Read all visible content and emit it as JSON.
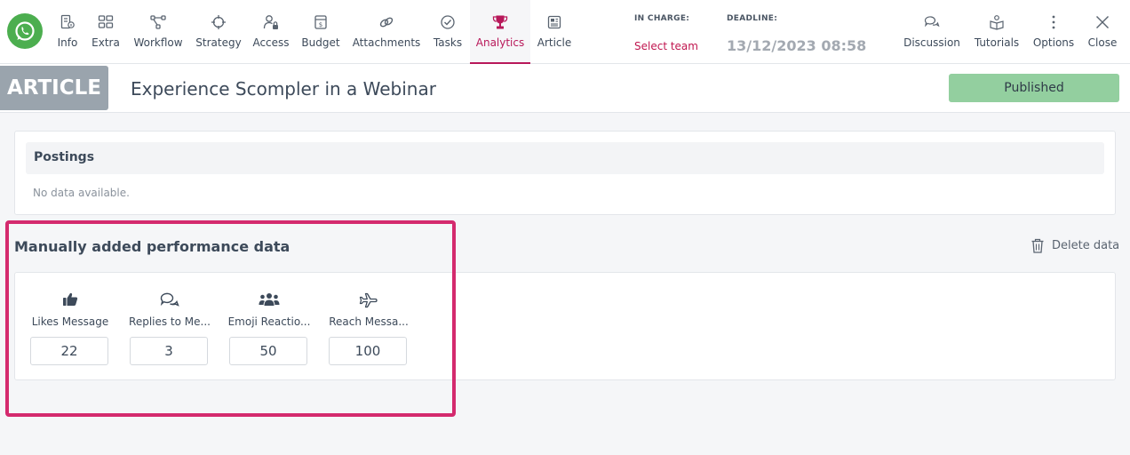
{
  "nav": {
    "items": [
      {
        "label": "Info",
        "icon": "info-doc-icon"
      },
      {
        "label": "Extra",
        "icon": "extra-icon"
      },
      {
        "label": "Workflow",
        "icon": "workflow-icon"
      },
      {
        "label": "Strategy",
        "icon": "crosshair-icon"
      },
      {
        "label": "Access",
        "icon": "user-lock-icon"
      },
      {
        "label": "Budget",
        "icon": "money-icon"
      },
      {
        "label": "Attachments",
        "icon": "link-icon"
      },
      {
        "label": "Tasks",
        "icon": "check-circle-icon"
      },
      {
        "label": "Analytics",
        "icon": "trophy-icon",
        "active": true
      },
      {
        "label": "Article",
        "icon": "newspaper-icon"
      }
    ],
    "right_items": [
      {
        "label": "Discussion",
        "icon": "chat-icon"
      },
      {
        "label": "Tutorials",
        "icon": "tutorials-icon"
      },
      {
        "label": "Options",
        "icon": "kebab-icon"
      },
      {
        "label": "Close",
        "icon": "close-icon"
      }
    ]
  },
  "in_charge": {
    "label": "IN CHARGE:",
    "value": "Select team"
  },
  "deadline": {
    "label": "DEADLINE:",
    "value": "13/12/2023 08:58"
  },
  "header": {
    "badge": "ARTICLE",
    "title": "Experience Scompler in a Webinar",
    "status_button": "Published"
  },
  "postings": {
    "title": "Postings",
    "empty_text": "No data available."
  },
  "performance": {
    "title": "Manually added performance data",
    "delete_label": "Delete data",
    "metrics": [
      {
        "label": "Likes Message",
        "value": "22",
        "icon": "thumbs-up-icon"
      },
      {
        "label": "Replies to Me...",
        "value": "3",
        "icon": "comments-icon"
      },
      {
        "label": "Emoji Reactio...",
        "value": "50",
        "icon": "users-icon"
      },
      {
        "label": "Reach Messa...",
        "value": "100",
        "icon": "plane-icon"
      }
    ]
  },
  "colors": {
    "accent": "#b8185a",
    "whatsapp": "#4cae4f",
    "published": "#93cf9f",
    "highlight": "#d42a6e"
  }
}
